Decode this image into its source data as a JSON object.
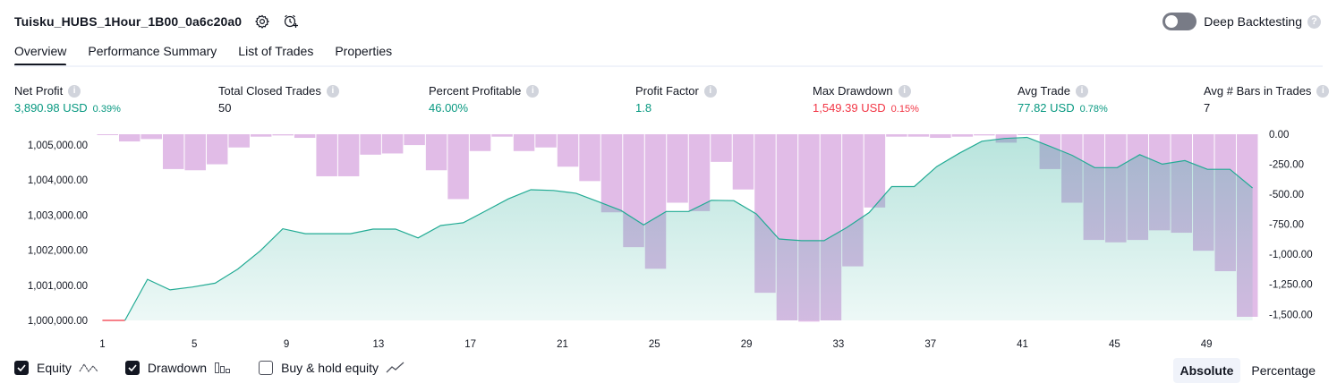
{
  "header": {
    "title": "Tuisku_HUBS_1Hour_1B00_0a6c20a0",
    "settings_icon": "gear-icon",
    "alert_icon": "add-alert-icon",
    "deep_backtesting_label": "Deep Backtesting",
    "deep_backtesting_on": false,
    "help_glyph": "?"
  },
  "tabs": [
    {
      "label": "Overview",
      "active": true
    },
    {
      "label": "Performance Summary",
      "active": false
    },
    {
      "label": "List of Trades",
      "active": false
    },
    {
      "label": "Properties",
      "active": false
    }
  ],
  "metrics": [
    {
      "label": "Net Profit",
      "value": "3,890.98 USD",
      "pct": "0.39%",
      "color": "#089981"
    },
    {
      "label": "Total Closed Trades",
      "value": "50",
      "pct": "",
      "color": "#131722"
    },
    {
      "label": "Percent Profitable",
      "value": "46.00%",
      "pct": "",
      "color": "#089981"
    },
    {
      "label": "Profit Factor",
      "value": "1.8",
      "pct": "",
      "color": "#089981"
    },
    {
      "label": "Max Drawdown",
      "value": "1,549.39 USD",
      "pct": "0.15%",
      "color": "#f23645"
    },
    {
      "label": "Avg Trade",
      "value": "77.82 USD",
      "pct": "0.78%",
      "color": "#089981"
    },
    {
      "label": "Avg # Bars in Trades",
      "value": "7",
      "pct": "",
      "color": "#131722"
    }
  ],
  "chart_data": {
    "type": "area",
    "x_ticks": [
      "1",
      "5",
      "9",
      "13",
      "17",
      "21",
      "25",
      "29",
      "33",
      "37",
      "41",
      "45",
      "49"
    ],
    "x_range": [
      1,
      51
    ],
    "equity": {
      "name": "Equity",
      "ylim": [
        1000000,
        1005300
      ],
      "y_ticks": [
        "1,000,000.00",
        "1,001,000.00",
        "1,002,000.00",
        "1,003,000.00",
        "1,004,000.00",
        "1,005,000.00"
      ],
      "values": [
        1000000,
        1000000,
        1001170,
        1000870,
        1000950,
        1001060,
        1001460,
        1001980,
        1002610,
        1002470,
        1002470,
        1002470,
        1002600,
        1002600,
        1002350,
        1002700,
        1002780,
        1003120,
        1003460,
        1003720,
        1003700,
        1003620,
        1003380,
        1003130,
        1002720,
        1003100,
        1003100,
        1003420,
        1003410,
        1003030,
        1002320,
        1002270,
        1002270,
        1002640,
        1003070,
        1003810,
        1003810,
        1004380,
        1004760,
        1005100,
        1005180,
        1005210,
        1004960,
        1004700,
        1004350,
        1004350,
        1004720,
        1004450,
        1004550,
        1004300,
        1004300,
        1003770
      ],
      "line_color": "#22ab94",
      "negative_color": "#f23645"
    },
    "drawdown": {
      "name": "Drawdown",
      "ylim": [
        -1550,
        0
      ],
      "y_ticks": [
        "0.00",
        "-250.00",
        "-500.00",
        "-750.00",
        "-1,000.00",
        "-1,250.00",
        "-1,500.00"
      ],
      "values": [
        -2,
        -60,
        -40,
        -290,
        -300,
        -250,
        -110,
        -20,
        -10,
        -30,
        -350,
        -350,
        -170,
        -160,
        -90,
        -300,
        -540,
        -140,
        -20,
        -140,
        -110,
        -270,
        -390,
        -650,
        -940,
        -1120,
        -570,
        -640,
        -230,
        -460,
        -1320,
        -1550,
        -1560,
        -1550,
        -1100,
        -610,
        -20,
        -20,
        -30,
        -20,
        -10,
        -70,
        -5,
        -290,
        -570,
        -880,
        -900,
        -880,
        -800,
        -820,
        -970,
        -1140,
        -1520
      ],
      "color": "#ce93d8"
    }
  },
  "legend": {
    "equity_label": "Equity",
    "equity_checked": true,
    "equity_icon": "equity-line-icon",
    "drawdown_label": "Drawdown",
    "drawdown_checked": true,
    "drawdown_icon": "drawdown-bars-icon",
    "buyhold_label": "Buy & hold equity",
    "buyhold_checked": false,
    "buyhold_icon": "buy-hold-line-icon"
  },
  "modes": [
    {
      "label": "Absolute",
      "active": true
    },
    {
      "label": "Percentage",
      "active": false
    }
  ]
}
